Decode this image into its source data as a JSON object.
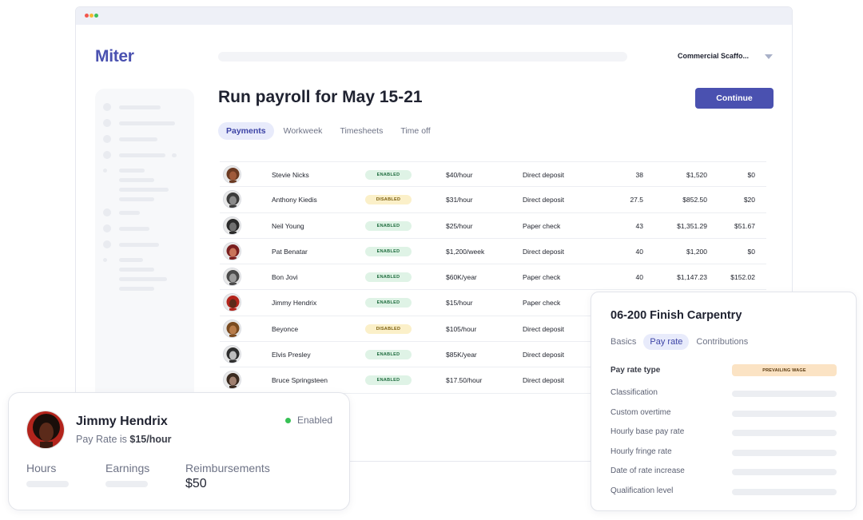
{
  "app": {
    "logo": "Miter",
    "company": "Commercial Scaffo..."
  },
  "page": {
    "title": "Run payroll for May 15-21",
    "continue_label": "Continue",
    "tabs": [
      {
        "label": "Payments",
        "active": true
      },
      {
        "label": "Workweek",
        "active": false
      },
      {
        "label": "Timesheets",
        "active": false
      },
      {
        "label": "Time off",
        "active": false
      }
    ]
  },
  "employees": [
    {
      "name": "Stevie Nicks",
      "status": "ENABLED",
      "rate": "$40/hour",
      "method": "Direct deposit",
      "hours": "38",
      "earnings": "$1,520",
      "reimb": "$0",
      "avatar_color": "#a05a3a",
      "hair_color": "#6b3a22"
    },
    {
      "name": "Anthony Kiedis",
      "status": "DISABLED",
      "rate": "$31/hour",
      "method": "Direct deposit",
      "hours": "27.5",
      "earnings": "$852.50",
      "reimb": "$20",
      "avatar_color": "#8a8a8a",
      "hair_color": "#3c3c3c"
    },
    {
      "name": "Neil Young",
      "status": "ENABLED",
      "rate": "$25/hour",
      "method": "Paper check",
      "hours": "43",
      "earnings": "$1,351.29",
      "reimb": "$51.67",
      "avatar_color": "#707070",
      "hair_color": "#2a2a2a"
    },
    {
      "name": "Pat Benatar",
      "status": "ENABLED",
      "rate": "$1,200/week",
      "method": "Direct deposit",
      "hours": "40",
      "earnings": "$1,200",
      "reimb": "$0",
      "avatar_color": "#c9745a",
      "hair_color": "#7a1f1f"
    },
    {
      "name": "Bon Jovi",
      "status": "ENABLED",
      "rate": "$60K/year",
      "method": "Paper check",
      "hours": "40",
      "earnings": "$1,147.23",
      "reimb": "$152.02",
      "avatar_color": "#9b9b9b",
      "hair_color": "#4a4a4a"
    },
    {
      "name": "Jimmy Hendrix",
      "status": "ENABLED",
      "rate": "$15/hour",
      "method": "Paper check",
      "hours": "",
      "earnings": "",
      "reimb": "",
      "avatar_color": "#5b2a1a",
      "hair_color": "#b3241c"
    },
    {
      "name": "Beyonce",
      "status": "DISABLED",
      "rate": "$105/hour",
      "method": "Direct deposit",
      "hours": "",
      "earnings": "",
      "reimb": "",
      "avatar_color": "#b87c4a",
      "hair_color": "#7a4b20"
    },
    {
      "name": "Elvis Presley",
      "status": "ENABLED",
      "rate": "$85K/year",
      "method": "Direct deposit",
      "hours": "",
      "earnings": "",
      "reimb": "",
      "avatar_color": "#bdbdbd",
      "hair_color": "#2e2e2e"
    },
    {
      "name": "Bruce Springsteen",
      "status": "ENABLED",
      "rate": "$17.50/hour",
      "method": "Direct deposit",
      "hours": "",
      "earnings": "",
      "reimb": "",
      "avatar_color": "#a08070",
      "hair_color": "#3a2a20"
    }
  ],
  "employee_card": {
    "name": "Jimmy Hendrix",
    "pay_rate_prefix": "Pay Rate is ",
    "pay_rate_value": "$15/hour",
    "status": "Enabled",
    "hours_label": "Hours",
    "earnings_label": "Earnings",
    "reimb_label": "Reimbursements",
    "reimb_value": "$50"
  },
  "job_card": {
    "title": "06-200 Finish Carpentry",
    "tabs": [
      {
        "label": "Basics",
        "active": false
      },
      {
        "label": "Pay rate",
        "active": true
      },
      {
        "label": "Contributions",
        "active": false
      }
    ],
    "pay_rate_type_label": "Pay rate type",
    "pay_rate_type_value": "PREVAILING WAGE",
    "fields": [
      "Classification",
      "Custom overtime",
      "Hourly base pay rate",
      "Hourly fringe rate",
      "Date of rate increase",
      "Qualification level"
    ]
  },
  "colors": {
    "brand": "#4a51b0",
    "enabled_bg": "#dff3e6",
    "disabled_bg": "#fbf0c9",
    "status_dot": "#37c155"
  }
}
